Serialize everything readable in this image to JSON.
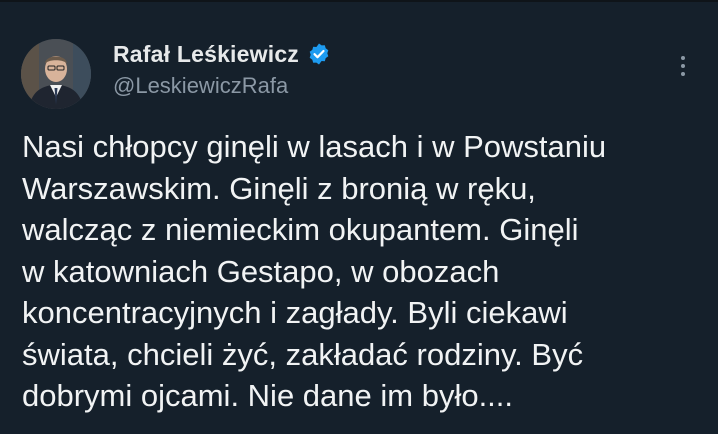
{
  "tweet": {
    "author": {
      "display_name": "Rafał Leśkiewicz",
      "handle": "@LeskiewiczRafa",
      "verified": true,
      "verified_color": "#1d9bf0"
    },
    "more_icon": "more-horizontal-dots-icon",
    "text_lines": [
      "Nasi chłopcy ginęli w lasach i w Powstaniu",
      "Warszawskim. Ginęli z bronią w ręku,",
      "walcząc z niemieckim okupantem. Ginęli",
      "w katowniach Gestapo, w obozach",
      "koncentracyjnych i zagłady. Byli ciekawi",
      "świata, chcieli żyć, zakładać rodziny. Być",
      "dobrymi ojcami. Nie dane im było...."
    ]
  },
  "colors": {
    "background": "#15202b",
    "text": "#e7e9ea",
    "secondary_text": "#8b98a5",
    "accent": "#1d9bf0"
  }
}
